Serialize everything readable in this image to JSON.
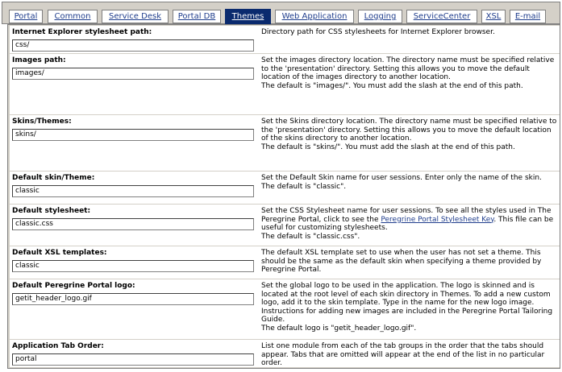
{
  "tabs": [
    {
      "label": "Portal",
      "active": false
    },
    {
      "label": "Common",
      "active": false
    },
    {
      "label": "Service Desk",
      "active": false
    },
    {
      "label": "Portal DB",
      "active": false
    },
    {
      "label": "Themes",
      "active": true
    },
    {
      "label": "Web Application",
      "active": false
    },
    {
      "label": "Logging",
      "active": false
    },
    {
      "label": "ServiceCenter",
      "active": false
    },
    {
      "label": "XSL",
      "active": false
    },
    {
      "label": "E-mail",
      "active": false
    }
  ],
  "settings": {
    "ie_stylesheet": {
      "label": "Internet Explorer stylesheet path:",
      "value": "css/",
      "description": "Directory path for CSS stylesheets for Internet Explorer browser."
    },
    "images_path": {
      "label": "Images path:",
      "value": "images/",
      "description": "Set the images directory location. The directory name must be specified relative to the 'presentation' directory. Setting this allows you to move the default location of the images directory to another location.",
      "default_note": "The default is \"images/\". You must add the slash at the end of this path."
    },
    "skins_themes": {
      "label": "Skins/Themes:",
      "value": "skins/",
      "description": "Set the Skins directory location. The directory name must be specified relative to the 'presentation' directory. Setting this allows you to move the default location of the skins directory to another location.",
      "default_note": "The default is \"skins/\". You must add the slash at the end of this path."
    },
    "default_skin": {
      "label": "Default skin/Theme:",
      "value": "classic",
      "description": "Set the Default Skin name for user sessions. Enter only the name of the skin.",
      "default_note": "The default is \"classic\"."
    },
    "default_stylesheet": {
      "label": "Default stylesheet:",
      "value": "classic.css",
      "description_before": "Set the CSS Stylesheet name for user sessions. To see all the styles used in The Peregrine Portal, click to see the ",
      "link_text": "Peregrine Portal Stylesheet Key",
      "description_after": ". This file can be useful for customizing stylesheets.",
      "default_note": "The default is \"classic.css\"."
    },
    "default_xsl": {
      "label": "Default XSL templates:",
      "value": "classic",
      "description": "The default XSL template set to use when the user has not set a theme. This should be the same as the default skin when specifying a theme provided by Peregrine Portal."
    },
    "portal_logo": {
      "label": "Default Peregrine Portal logo:",
      "value": "getit_header_logo.gif",
      "description": "Set the global logo to be used in the application. The logo is skinned and is located at the root level of each skin directory in Themes. To add a new custom logo, add it to the skin template. Type in the name for the new logo image. Instructions for adding new images are included in the Peregrine Portal Tailoring Guide.",
      "default_note": "The default logo is \"getit_header_logo.gif\"."
    },
    "tab_order": {
      "label": "Application Tab Order:",
      "value": "portal",
      "description": "List one module from each of the tab groups in the order that the tabs should appear. Tabs that are omitted will appear at the end of the list in no particular order."
    }
  },
  "colors": {
    "tab_active_bg": "#0a2a6e",
    "link": "#1f3d8c",
    "panel_bg": "#d4d0c8"
  }
}
